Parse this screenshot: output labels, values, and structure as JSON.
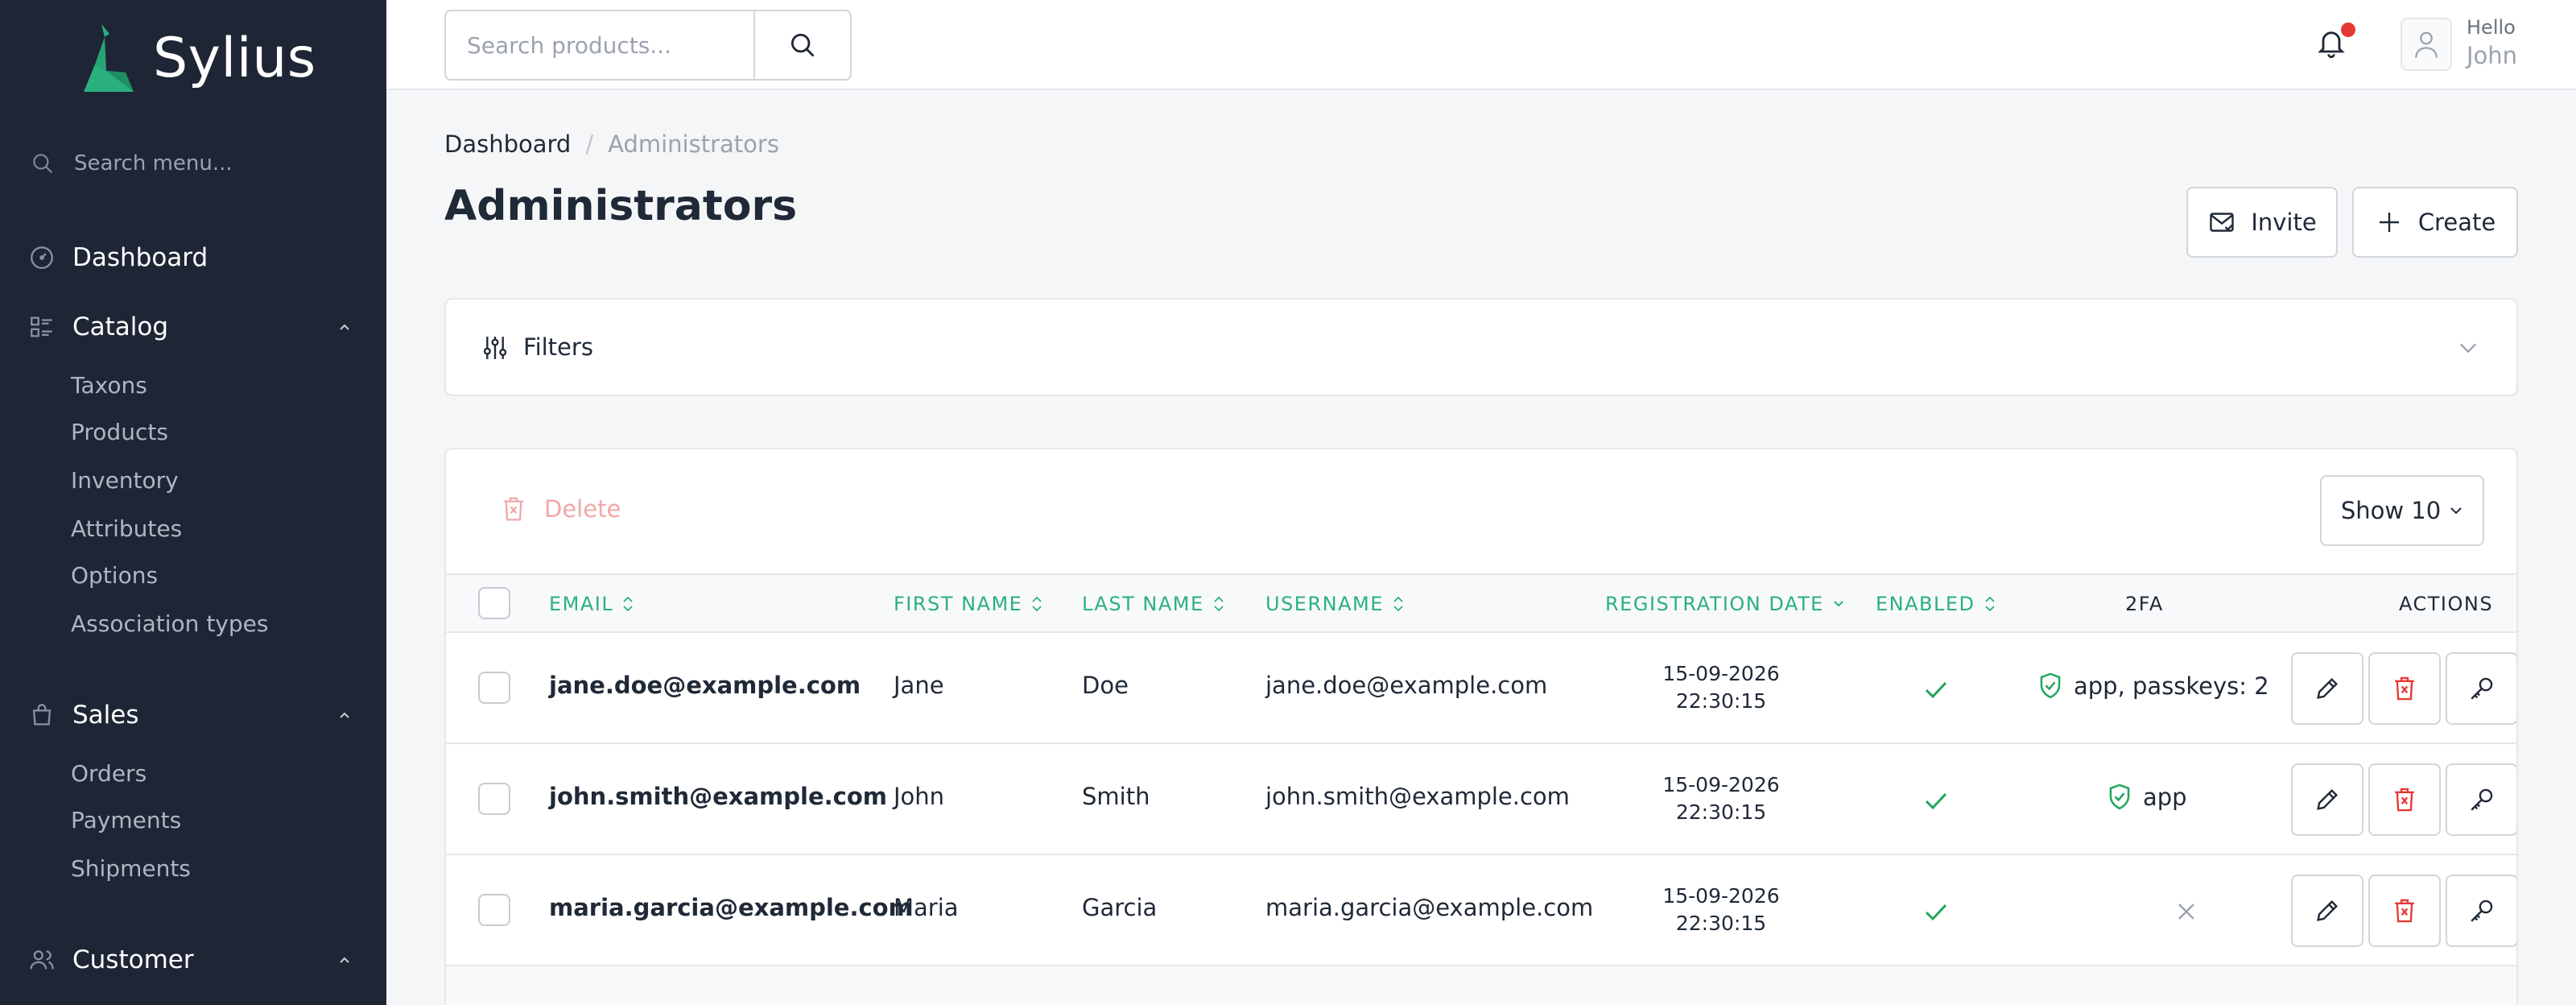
{
  "brand": {
    "name": "Sylius"
  },
  "sidebar": {
    "search_placeholder": "Search menu...",
    "sections": [
      {
        "label": "Dashboard",
        "icon": "dashboard-icon"
      },
      {
        "label": "Catalog",
        "icon": "catalog-icon",
        "items": [
          "Taxons",
          "Products",
          "Inventory",
          "Attributes",
          "Options",
          "Association types"
        ]
      },
      {
        "label": "Sales",
        "icon": "shopping-bag-icon",
        "items": [
          "Orders",
          "Payments",
          "Shipments"
        ]
      },
      {
        "label": "Customer",
        "icon": "users-icon"
      }
    ]
  },
  "topbar": {
    "search_placeholder": "Search products...",
    "user": {
      "greeting": "Hello",
      "name": "John"
    }
  },
  "breadcrumb": [
    "Dashboard",
    "Administrators"
  ],
  "page_title": "Administrators",
  "actions": {
    "invite": "Invite",
    "create": "Create"
  },
  "filters": {
    "label": "Filters"
  },
  "toolbar": {
    "delete": "Delete",
    "show": "Show 10"
  },
  "table": {
    "columns": [
      "EMAIL",
      "FIRST NAME",
      "LAST NAME",
      "USERNAME",
      "REGISTRATION DATE",
      "ENABLED",
      "2FA",
      "ACTIONS"
    ],
    "rows": [
      {
        "email": "jane.doe@example.com",
        "first_name": "Jane",
        "last_name": "Doe",
        "username": "jane.doe@example.com",
        "date": "15-09-2026",
        "time": "22:30:15",
        "enabled": true,
        "tfa": "app, passkeys: 2"
      },
      {
        "email": "john.smith@example.com",
        "first_name": "John",
        "last_name": "Smith",
        "username": "john.smith@example.com",
        "date": "15-09-2026",
        "time": "22:30:15",
        "enabled": true,
        "tfa": "app"
      },
      {
        "email": "maria.garcia@example.com",
        "first_name": "Maria",
        "last_name": "Garcia",
        "username": "maria.garcia@example.com",
        "date": "15-09-2026",
        "time": "22:30:15",
        "enabled": true,
        "tfa": ""
      }
    ]
  },
  "colors": {
    "sidebar_bg": "#1e2636",
    "accent": "#2ab07f",
    "danger": "#e53935",
    "success": "#22a55b"
  }
}
